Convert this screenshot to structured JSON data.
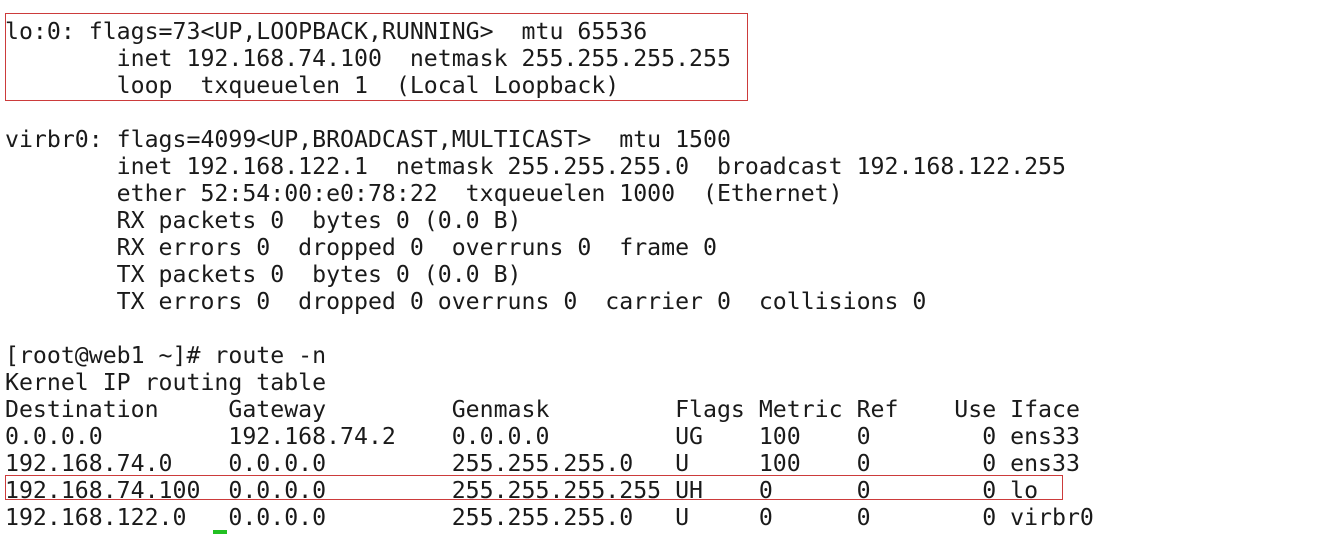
{
  "terminal": {
    "lines": [
      "lo:0: flags=73<UP,LOOPBACK,RUNNING>  mtu 65536",
      "        inet 192.168.74.100  netmask 255.255.255.255",
      "        loop  txqueuelen 1  (Local Loopback)",
      "",
      "virbr0: flags=4099<UP,BROADCAST,MULTICAST>  mtu 1500",
      "        inet 192.168.122.1  netmask 255.255.255.0  broadcast 192.168.122.255",
      "        ether 52:54:00:e0:78:22  txqueuelen 1000  (Ethernet)",
      "        RX packets 0  bytes 0 (0.0 B)",
      "        RX errors 0  dropped 0  overruns 0  frame 0",
      "        TX packets 0  bytes 0 (0.0 B)",
      "        TX errors 0  dropped 0 overruns 0  carrier 0  collisions 0",
      "",
      "[root@web1 ~]# route -n",
      "Kernel IP routing table",
      "Destination     Gateway         Genmask         Flags Metric Ref    Use Iface",
      "0.0.0.0         192.168.74.2    0.0.0.0         UG    100    0        0 ens33",
      "192.168.74.0    0.0.0.0         255.255.255.0   U     100    0        0 ens33",
      "192.168.74.100  0.0.0.0         255.255.255.255 UH    0      0        0 lo",
      "192.168.122.0   0.0.0.0         255.255.255.0   U     0      0        0 virbr0"
    ]
  },
  "colors": {
    "text": "#1a1a1a",
    "background": "#ffffff",
    "highlight_border": "#cc3b3b",
    "cursor": "#22c022"
  }
}
